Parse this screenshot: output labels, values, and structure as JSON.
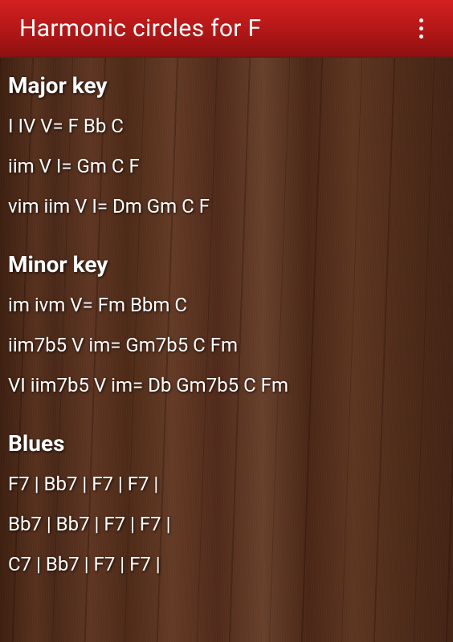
{
  "header": {
    "title": "Harmonic circles for F"
  },
  "sections": [
    {
      "heading": "Major key",
      "lines": [
        "I IV V= F Bb C",
        "iim V I= Gm C F",
        "vim iim V I= Dm Gm C F"
      ]
    },
    {
      "heading": "Minor key",
      "lines": [
        "im ivm V= Fm Bbm C",
        "iim7b5 V im= Gm7b5 C Fm",
        "VI iim7b5 V im= Db Gm7b5 C Fm"
      ]
    },
    {
      "heading": "Blues",
      "lines": [
        "F7 | Bb7 | F7 | F7 |",
        "Bb7 | Bb7 | F7 | F7 |",
        "C7 | Bb7 | F7 | F7 |"
      ]
    }
  ]
}
